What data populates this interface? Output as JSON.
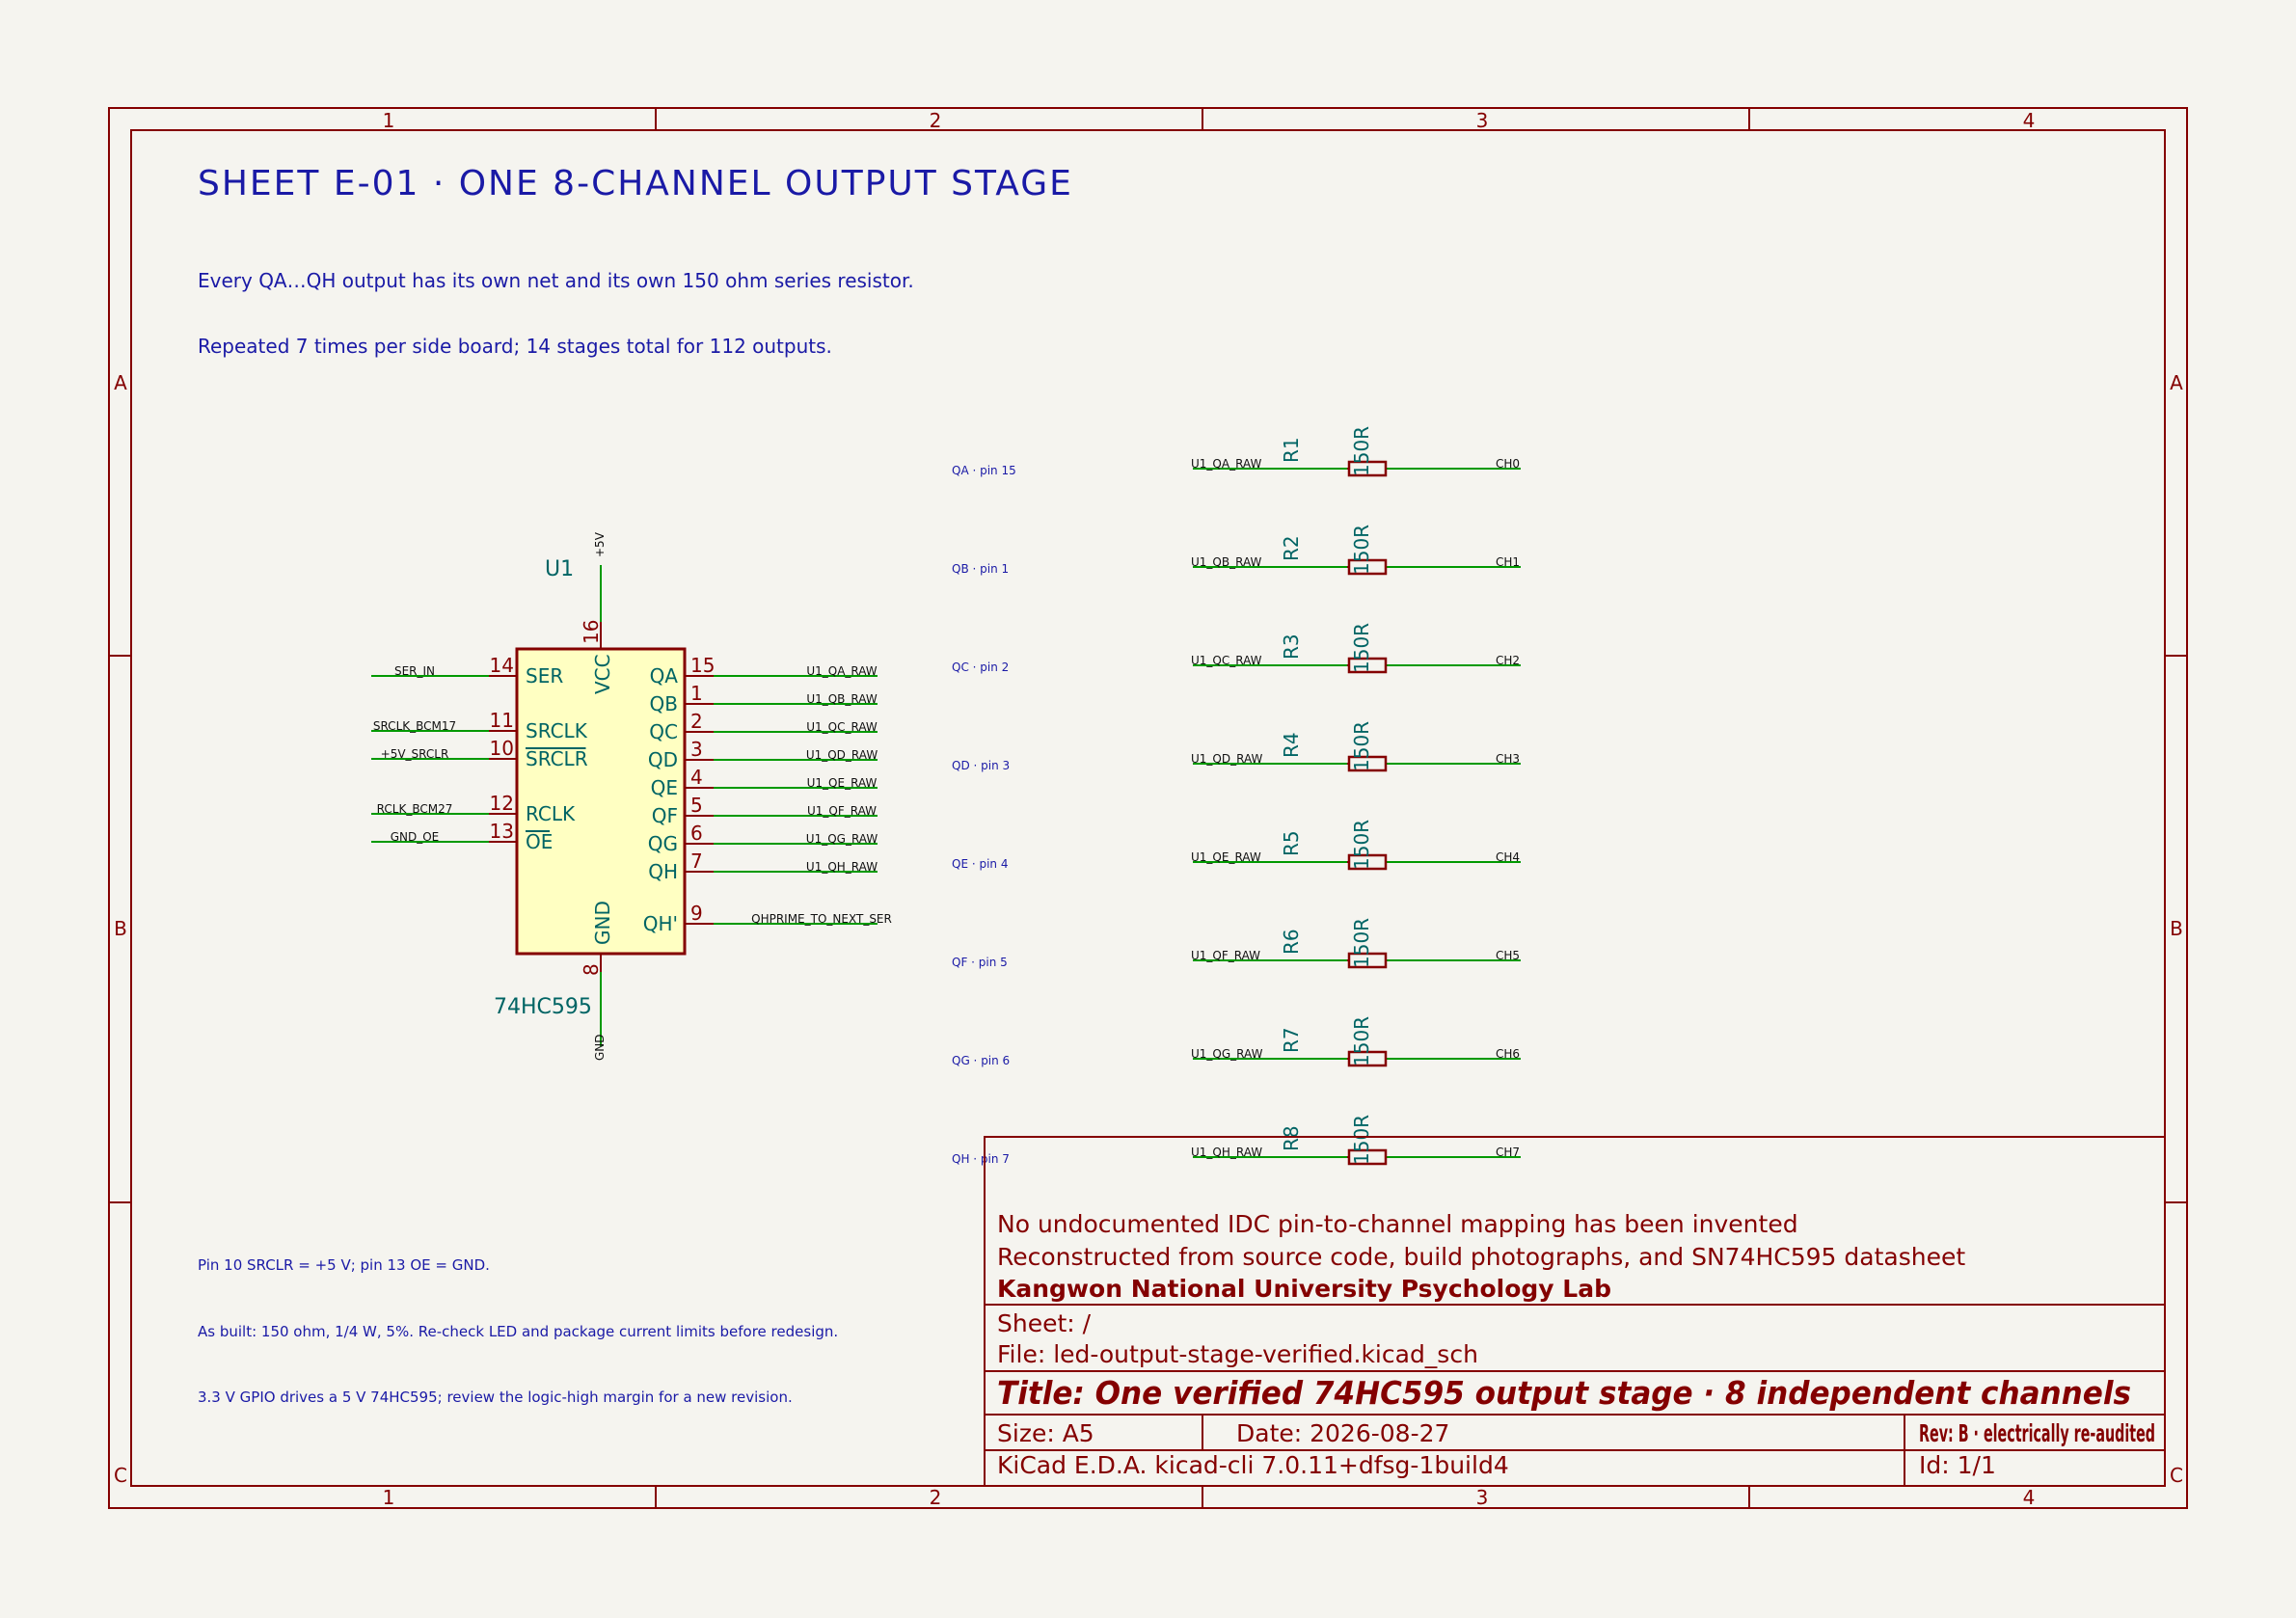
{
  "frame": {
    "columns": [
      "1",
      "2",
      "3",
      "4"
    ],
    "rows": [
      "A",
      "B",
      "C"
    ]
  },
  "sheet": {
    "heading": "SHEET E-01 · ONE 8-CHANNEL OUTPUT STAGE",
    "note1": "Every QA…QH output has its own net and its own 150 ohm series resistor.",
    "note2": "Repeated 7 times per side board; 14 stages total for 112 outputs.",
    "bottom_note1": "Pin 10 SRCLR = +5 V; pin 13 OE = GND.",
    "bottom_note2": "As built: 150 ohm, 1/4 W, 5%. Re-check LED and package current limits before redesign.",
    "bottom_note3": "3.3 V GPIO drives a 5 V 74HC595; review the logic-high margin for a new revision."
  },
  "ic": {
    "ref": "U1",
    "value": "74HC595",
    "power_label": "+5V",
    "ground_label": "GND",
    "vcc_pin": {
      "num": "16",
      "name": "VCC"
    },
    "gnd_pin": {
      "num": "8",
      "name": "GND"
    },
    "left_pins": [
      {
        "num": "14",
        "name": "SER",
        "net": "SER_IN",
        "overbar": false
      },
      {
        "num": "11",
        "name": "SRCLK",
        "net": "SRCLK_BCM17",
        "overbar": false
      },
      {
        "num": "10",
        "name": "SRCLR",
        "net": "+5V_SRCLR",
        "overbar": true
      },
      {
        "num": "12",
        "name": "RCLK",
        "net": "RCLK_BCM27",
        "overbar": false
      },
      {
        "num": "13",
        "name": "OE",
        "net": "GND_OE",
        "overbar": true
      }
    ],
    "right_pins": [
      {
        "num": "15",
        "name": "QA",
        "net": "U1_QA_RAW"
      },
      {
        "num": "1",
        "name": "QB",
        "net": "U1_QB_RAW"
      },
      {
        "num": "2",
        "name": "QC",
        "net": "U1_QC_RAW"
      },
      {
        "num": "3",
        "name": "QD",
        "net": "U1_QD_RAW"
      },
      {
        "num": "4",
        "name": "QE",
        "net": "U1_QE_RAW"
      },
      {
        "num": "5",
        "name": "QF",
        "net": "U1_QF_RAW"
      },
      {
        "num": "6",
        "name": "QG",
        "net": "U1_QG_RAW"
      },
      {
        "num": "7",
        "name": "QH",
        "net": "U1_QH_RAW"
      }
    ],
    "qh_prime": {
      "num": "9",
      "name": "QH'",
      "net": "QHPRIME_TO_NEXT_SER"
    }
  },
  "channels": [
    {
      "pin_label": "QA · pin 15",
      "ref": "R1",
      "value": "150R",
      "in_net": "U1_QA_RAW",
      "out_net": "CH0"
    },
    {
      "pin_label": "QB · pin 1",
      "ref": "R2",
      "value": "150R",
      "in_net": "U1_QB_RAW",
      "out_net": "CH1"
    },
    {
      "pin_label": "QC · pin 2",
      "ref": "R3",
      "value": "150R",
      "in_net": "U1_QC_RAW",
      "out_net": "CH2"
    },
    {
      "pin_label": "QD · pin 3",
      "ref": "R4",
      "value": "150R",
      "in_net": "U1_QD_RAW",
      "out_net": "CH3"
    },
    {
      "pin_label": "QE · pin 4",
      "ref": "R5",
      "value": "150R",
      "in_net": "U1_QE_RAW",
      "out_net": "CH4"
    },
    {
      "pin_label": "QF · pin 5",
      "ref": "R6",
      "value": "150R",
      "in_net": "U1_QF_RAW",
      "out_net": "CH5"
    },
    {
      "pin_label": "QG · pin 6",
      "ref": "R7",
      "value": "150R",
      "in_net": "U1_QG_RAW",
      "out_net": "CH6"
    },
    {
      "pin_label": "QH · pin 7",
      "ref": "R8",
      "value": "150R",
      "in_net": "U1_QH_RAW",
      "out_net": "CH7"
    }
  ],
  "title_block": {
    "comment1": "No undocumented IDC pin-to-channel mapping has been invented",
    "comment2": "Reconstructed from source code, build photographs, and SN74HC595 datasheet",
    "company": "Kangwon National University Psychology Lab",
    "sheet": "Sheet: /",
    "file": "File: led-output-stage-verified.kicad_sch",
    "title": "Title: One verified 74HC595 output stage · 8 independent channels",
    "size": "Size: A5",
    "date": "Date: 2026-08-27",
    "rev": "Rev: B · electrically re-audited",
    "tool": "KiCad E.D.A.  kicad-cli 7.0.11+dfsg-1build4",
    "id": "Id: 1/1"
  }
}
